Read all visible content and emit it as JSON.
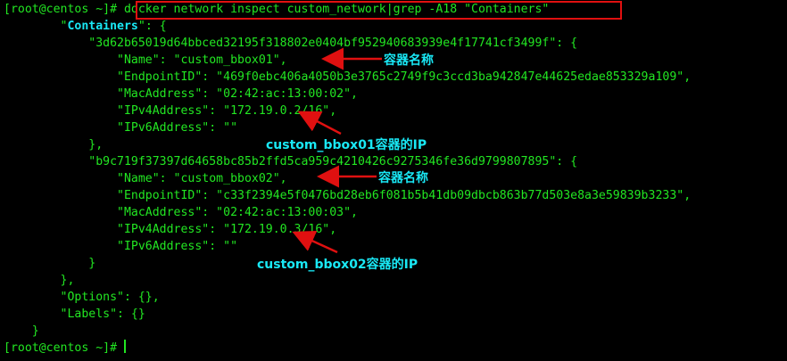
{
  "terminal": {
    "prompt": "[root@centos ~]# ",
    "command": "docker network inspect custom_network|grep -A18 \"Containers\"",
    "lines": [
      "        \"",
      "            \"3d62b65019d64bbced32195f318802e0404bf952940683939e4f17741cf3499f\": {",
      "                \"Name\": \"custom_bbox01\",",
      "                \"EndpointID\": \"469f0ebc406a4050b3e3765c2749f9c3ccd3ba942847e44625edae853329a109\",",
      "                \"MacAddress\": \"02:42:ac:13:00:02\",",
      "                \"IPv4Address\": \"172.19.0.2/16\",",
      "                \"IPv6Address\": \"\"",
      "            },",
      "            \"b9c719f37397d64658bc85b2ffd5ca959c4210426c9275346fe36d9799807895\": {",
      "                \"Name\": \"custom_bbox02\",",
      "                \"EndpointID\": \"c33f2394e5f0476bd28eb6f081b5b41db09dbcb863b77d503e8a3e59839b3233\",",
      "                \"MacAddress\": \"02:42:ac:13:00:03\",",
      "                \"IPv4Address\": \"172.19.0.3/16\",",
      "                \"IPv6Address\": \"\"",
      "            }",
      "        },",
      "        \"Options\": {},",
      "        \"Labels\": {}",
      "    }"
    ],
    "containers_key": "Containers",
    "containers_tail": "\": {",
    "final_prompt": "[root@centos ~]# "
  },
  "annotations": {
    "name1": "容器名称",
    "ip1": "custom_bbox01容器的IP",
    "name2": "容器名称",
    "ip2": "custom_bbox02容器的IP"
  },
  "colors": {
    "text": "#22e622",
    "highlight": "#19e8f5",
    "annotation": "#19e8f5",
    "arrow": "#e01010",
    "box": "#e01010",
    "background": "#000000"
  }
}
